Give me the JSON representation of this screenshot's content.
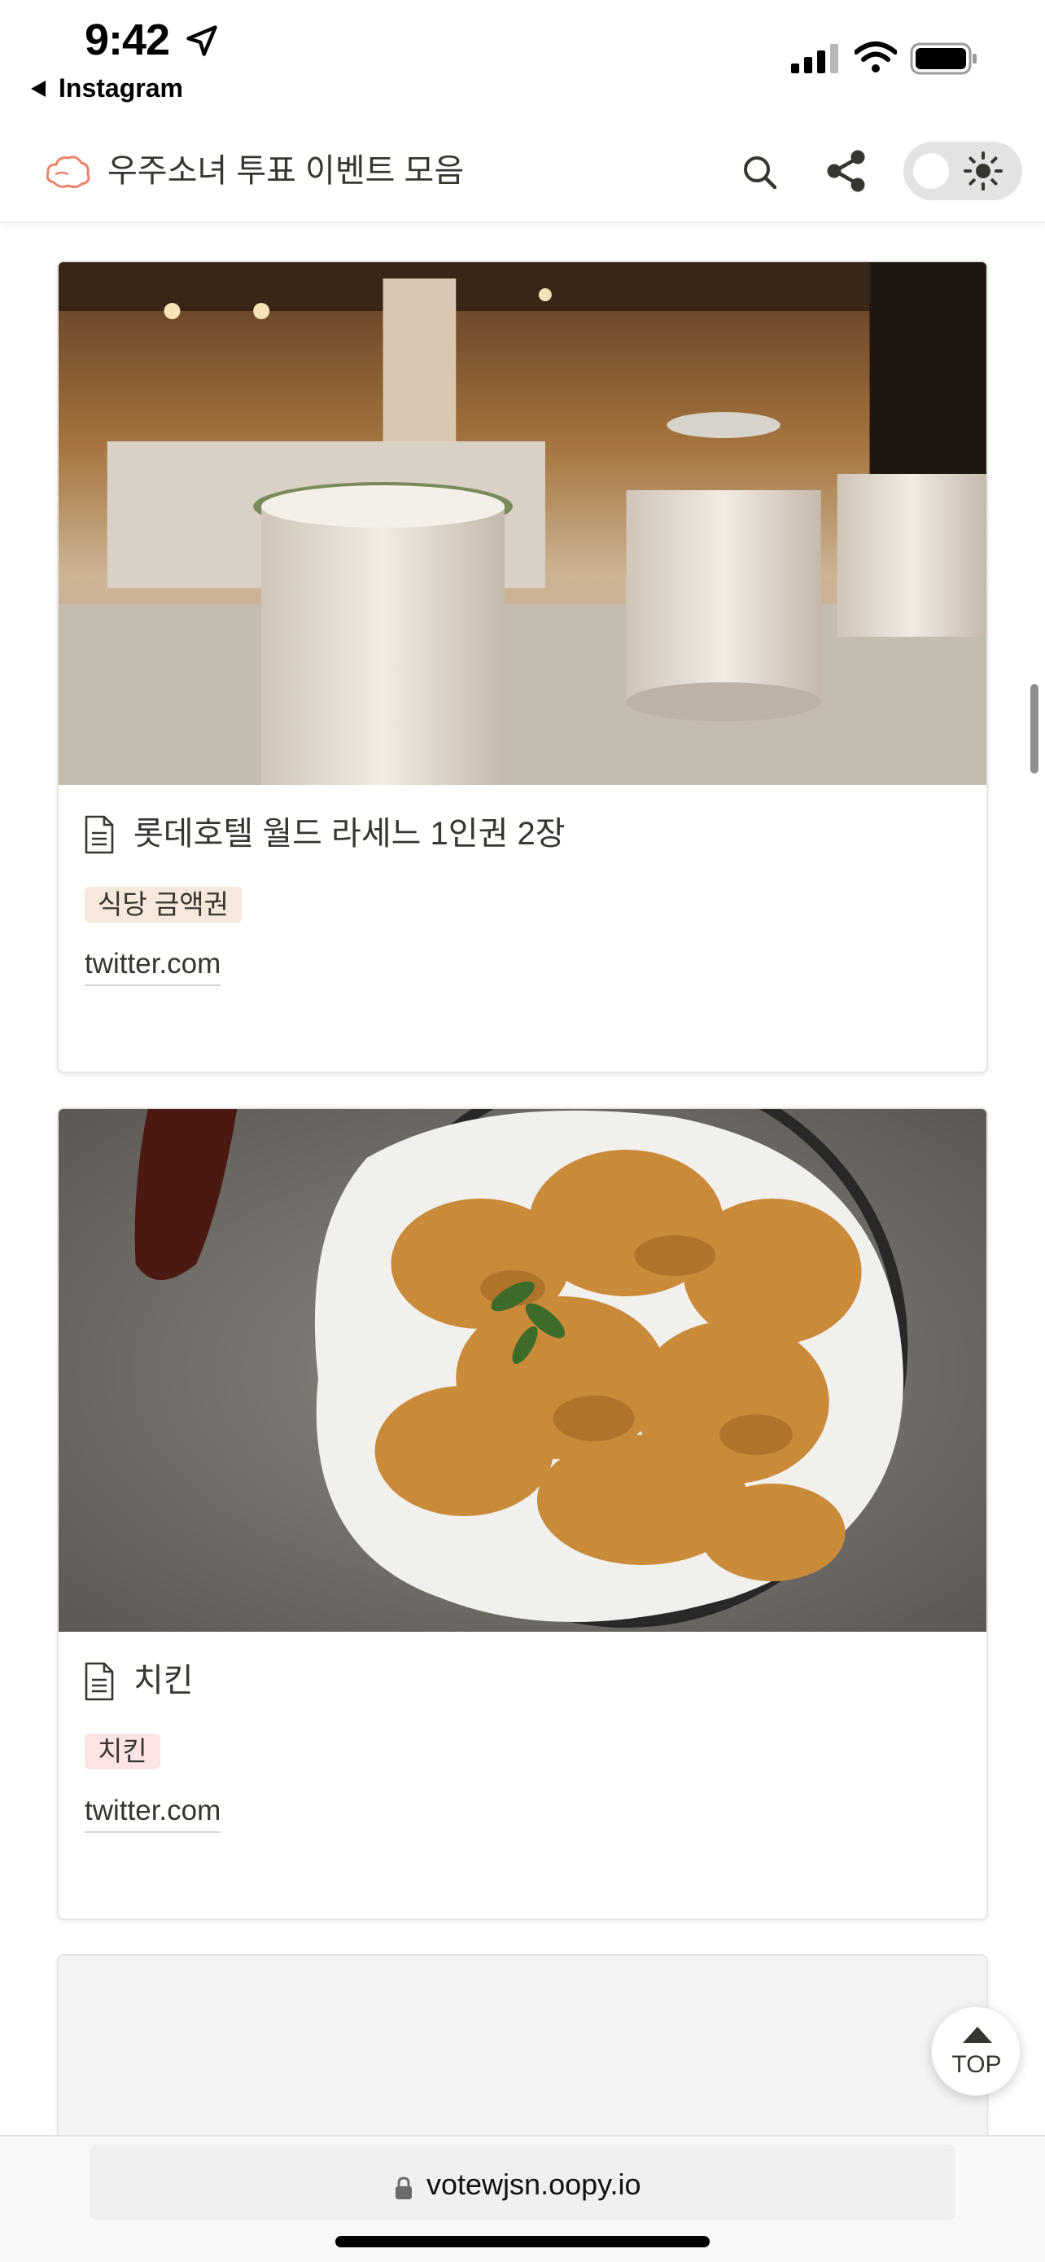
{
  "status_bar": {
    "time": "9:42",
    "back_app": "Instagram"
  },
  "header": {
    "title": "우주소녀 투표 이벤트 모음"
  },
  "cards": [
    {
      "title": "롯데호텔 월드 라세느 1인권 2장",
      "tag": "식당 금액권",
      "link": "twitter.com",
      "image": "hotel-buffet-photo"
    },
    {
      "title": "치킨",
      "tag": "치킨",
      "link": "twitter.com",
      "image": "fried-chicken-photo"
    }
  ],
  "top_button": {
    "label": "TOP"
  },
  "browser": {
    "url": "votewjsn.oopy.io"
  },
  "colors": {
    "text": "#37352f",
    "tag_brown": "#f6e9dc",
    "tag_red": "#fde4e4",
    "toggle_bg": "#e3e3e1"
  },
  "icons": [
    "location-arrow-icon",
    "signal-icon",
    "wifi-icon",
    "battery-icon",
    "cloud-logo-icon",
    "search-icon",
    "share-icon",
    "sun-icon",
    "document-icon",
    "lock-icon",
    "arrow-up-icon"
  ]
}
